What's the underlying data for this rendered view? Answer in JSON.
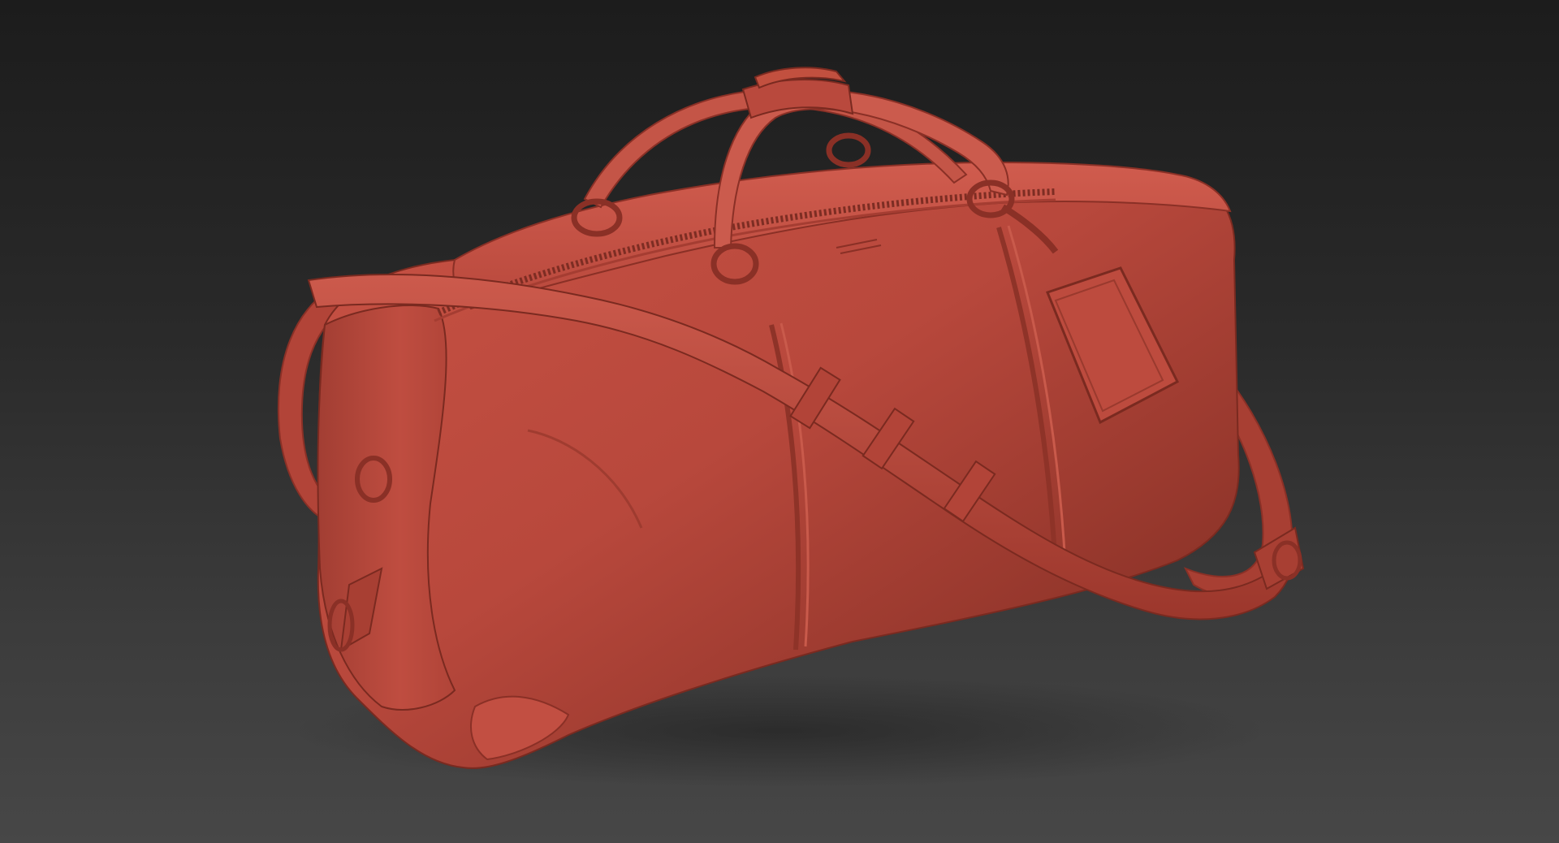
{
  "scene": {
    "background_top_color": "#1c1c1c",
    "background_bottom_color": "#474747",
    "model": {
      "subject": "duffel-bag-sculpt",
      "material_color": "#b8483c",
      "material_shadow_color": "#6e2018",
      "material_highlight_color": "#d06556",
      "parts": [
        "main-body",
        "top-handles",
        "handle-wrap",
        "shoulder-strap",
        "luggage-tag",
        "zipper",
        "d-rings",
        "snap-hooks",
        "corner-patch"
      ]
    }
  }
}
